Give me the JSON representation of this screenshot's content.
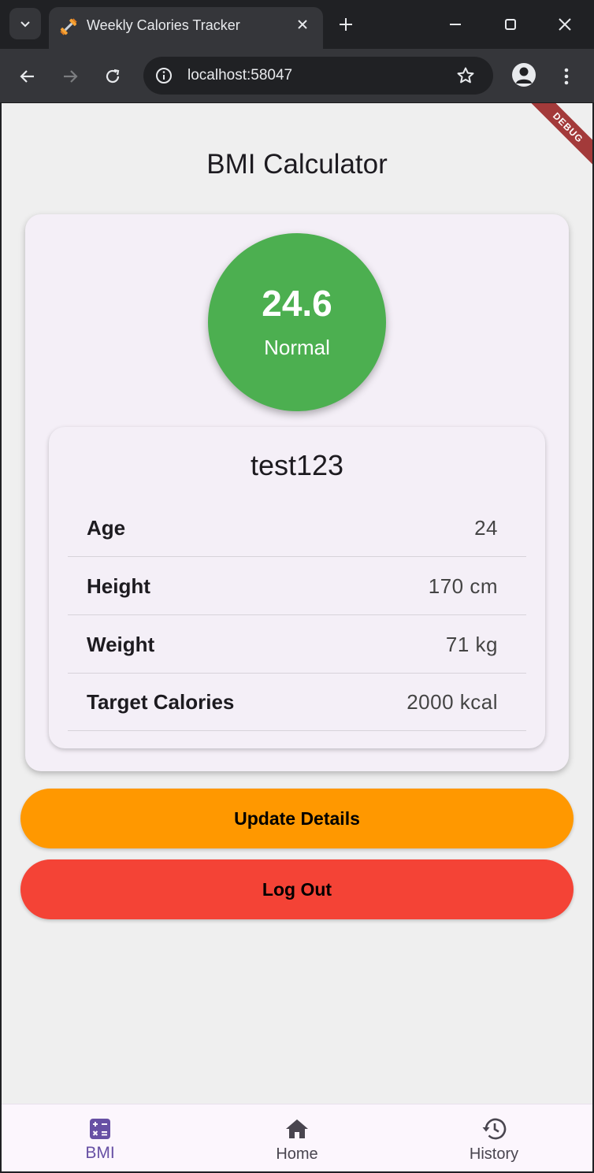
{
  "browser": {
    "tab_title": "Weekly Calories Tracker",
    "url": "localhost:58047"
  },
  "app": {
    "title": "BMI Calculator",
    "debug_banner": "DEBUG",
    "bmi": {
      "value": "24.6",
      "category": "Normal",
      "color": "#4caf50"
    },
    "profile": {
      "username": "test123",
      "rows": [
        {
          "label": "Age",
          "value": "24"
        },
        {
          "label": "Height",
          "value": "170 cm"
        },
        {
          "label": "Weight",
          "value": "71 kg"
        },
        {
          "label": "Target Calories",
          "value": "2000 kcal"
        }
      ]
    },
    "buttons": {
      "update_label": "Update Details",
      "update_color": "#ff9800",
      "logout_label": "Log Out",
      "logout_color": "#f44336"
    },
    "bottom_nav": {
      "items": [
        {
          "label": "BMI",
          "icon": "calculator-icon",
          "active": true
        },
        {
          "label": "Home",
          "icon": "home-icon",
          "active": false
        },
        {
          "label": "History",
          "icon": "history-icon",
          "active": false
        }
      ]
    }
  }
}
